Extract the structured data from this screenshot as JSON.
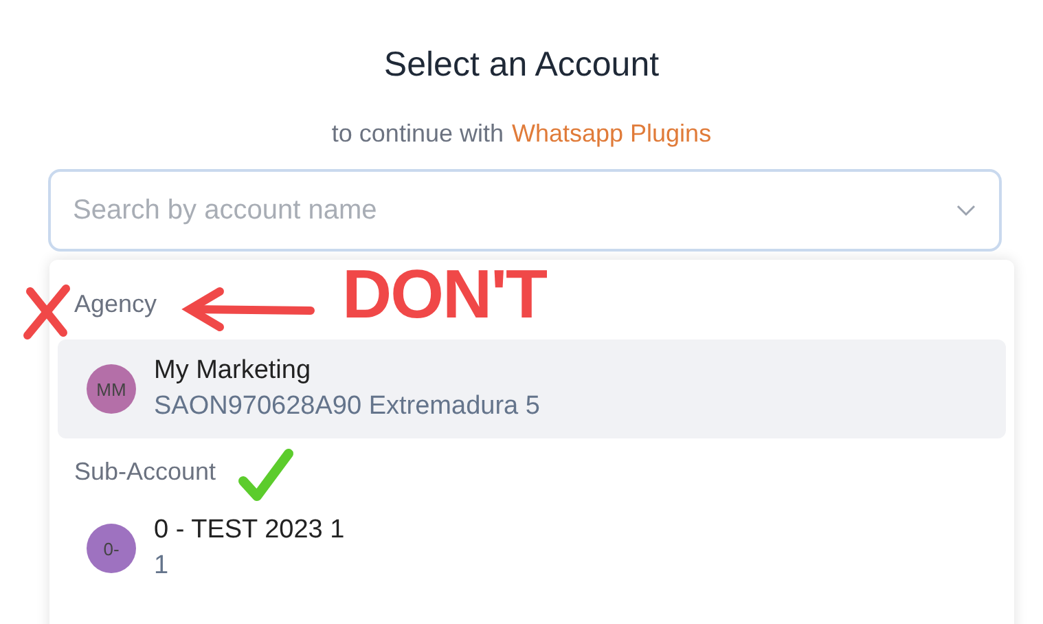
{
  "title": "Select an Account",
  "subtitle": {
    "text": "to continue with",
    "link": "Whatsapp Plugins"
  },
  "search": {
    "placeholder": "Search by account name"
  },
  "groups": [
    {
      "label": "Agency",
      "items": [
        {
          "initials": "MM",
          "name": "My Marketing",
          "detail": "SAON970628A90 Extremadura 5",
          "color": "#b46fa8",
          "selected": true
        }
      ]
    },
    {
      "label": "Sub-Account",
      "items": [
        {
          "initials": "0-",
          "name": "0 - TEST 2023 1",
          "detail": "1",
          "color": "#9e72c0",
          "selected": false
        }
      ]
    }
  ],
  "annotations": [
    {
      "kind": "cross"
    },
    {
      "kind": "arrow"
    },
    {
      "kind": "note",
      "text": "DON'T"
    },
    {
      "kind": "check"
    }
  ]
}
